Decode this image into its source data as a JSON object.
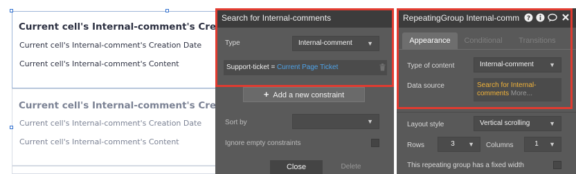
{
  "canvas": {
    "cells": [
      {
        "title": "Current cell's Internal-comment's Creator's",
        "line1": "Current cell's Internal-comment's Creation Date",
        "line2": "Current cell's Internal-comment's Content",
        "color": "#2d3142"
      },
      {
        "title": "Current cell's Internal-comment's Creator's",
        "line1": "Current cell's Internal-comment's Creation Date",
        "line2": "Current cell's Internal-comment's Content",
        "color": "#7b8294"
      }
    ]
  },
  "search_panel": {
    "title": "Search for Internal-comments",
    "type_label": "Type",
    "type_value": "Internal-comment",
    "constraint_key": "Support-ticket =",
    "constraint_value": "Current Page Ticket",
    "add_constraint_label": "Add a new constraint",
    "sort_by_label": "Sort by",
    "sort_by_value": "",
    "ignore_empty_label": "Ignore empty constraints",
    "close_label": "Close",
    "delete_label": "Delete"
  },
  "property_editor": {
    "title": "RepeatingGroup Internal-comm",
    "icons": [
      "help-icon",
      "info-icon",
      "comment-icon",
      "close-icon"
    ],
    "tabs": [
      "Appearance",
      "Conditional",
      "Transitions"
    ],
    "active_tab": "Appearance",
    "type_of_content_label": "Type of content",
    "type_of_content_value": "Internal-comment",
    "data_source_label": "Data source",
    "data_source_link": "Search for Internal-comments",
    "data_source_more": "More...",
    "layout_style_label": "Layout style",
    "layout_style_value": "Vertical scrolling",
    "rows_label": "Rows",
    "rows_value": "3",
    "columns_label": "Columns",
    "columns_value": "1",
    "fixed_width_label": "This repeating group has a fixed width"
  },
  "colors": {
    "highlight": "#e13b30",
    "link": "#4fa3e8",
    "data_source": "#f2b33a",
    "selection": "#2f6fcf"
  }
}
